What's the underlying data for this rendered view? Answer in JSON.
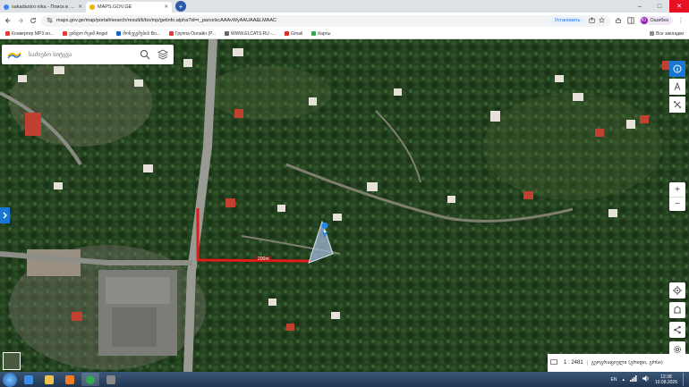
{
  "browser": {
    "tabs": [
      {
        "title": "sakadastro nika - Поиск в Goo",
        "favicon_color": "#4285f4",
        "active": false
      },
      {
        "title": "MAPS.GOV.GE",
        "favicon_color": "#f0b400",
        "active": true
      }
    ],
    "new_tab_symbol": "+",
    "window_controls": {
      "minimize": "–",
      "maximize": "□",
      "close": "✕"
    },
    "url": "maps.gov.ge/map/portal#search/result/ti/bo/mp/getinfo.alpha?id=r_parcelscAAAvWyAAUAA&LMAAC",
    "install_label": "Установить",
    "profile_label": "Ошибка",
    "profile_initial": "Ю"
  },
  "bookmarks": [
    {
      "label": "Конвертер MP3 он...",
      "color": "#e53935"
    },
    {
      "label": "ვინდო რჟიმ Angel",
      "color": "#e53935"
    },
    {
      "label": "მონეცემების Bo...",
      "color": "#1565c0"
    },
    {
      "label": "Группа Онлайн (P...",
      "color": "#e53935"
    },
    {
      "label": "WWW.ELCATS.RU -...",
      "color": "#666666"
    },
    {
      "label": "Gmail",
      "color": "#d93025"
    },
    {
      "label": "Карты",
      "color": "#34a853"
    }
  ],
  "bookmarks_all_label": "Все закладки",
  "map": {
    "search_placeholder": "საძიებო სიტყვა",
    "measure_label": "200m",
    "scale_ratio": "1 : 2481",
    "projection_label": "გეოგრაფიული (გრიდი, გრსი)",
    "icons": {
      "search": "search-icon",
      "layers": "layers-icon",
      "info": "info-icon",
      "measure": "measure-icon",
      "tools": "tools-icon",
      "zoom_in": "+",
      "zoom_out": "−",
      "locate": "locate-icon",
      "draw": "draw-icon",
      "share": "share-icon",
      "settings": "settings-icon"
    }
  },
  "taskbar": {
    "lang": "EN",
    "time": "12:38",
    "date": "10.08.2026",
    "apps": [
      {
        "name": "ie-icon",
        "color": "#3a8ee6"
      },
      {
        "name": "folder-icon",
        "color": "#f2c14e"
      },
      {
        "name": "media-icon",
        "color": "#f27c22"
      },
      {
        "name": "chrome-icon",
        "color": "#34a853"
      },
      {
        "name": "settings-app-icon",
        "color": "#888888"
      }
    ]
  }
}
